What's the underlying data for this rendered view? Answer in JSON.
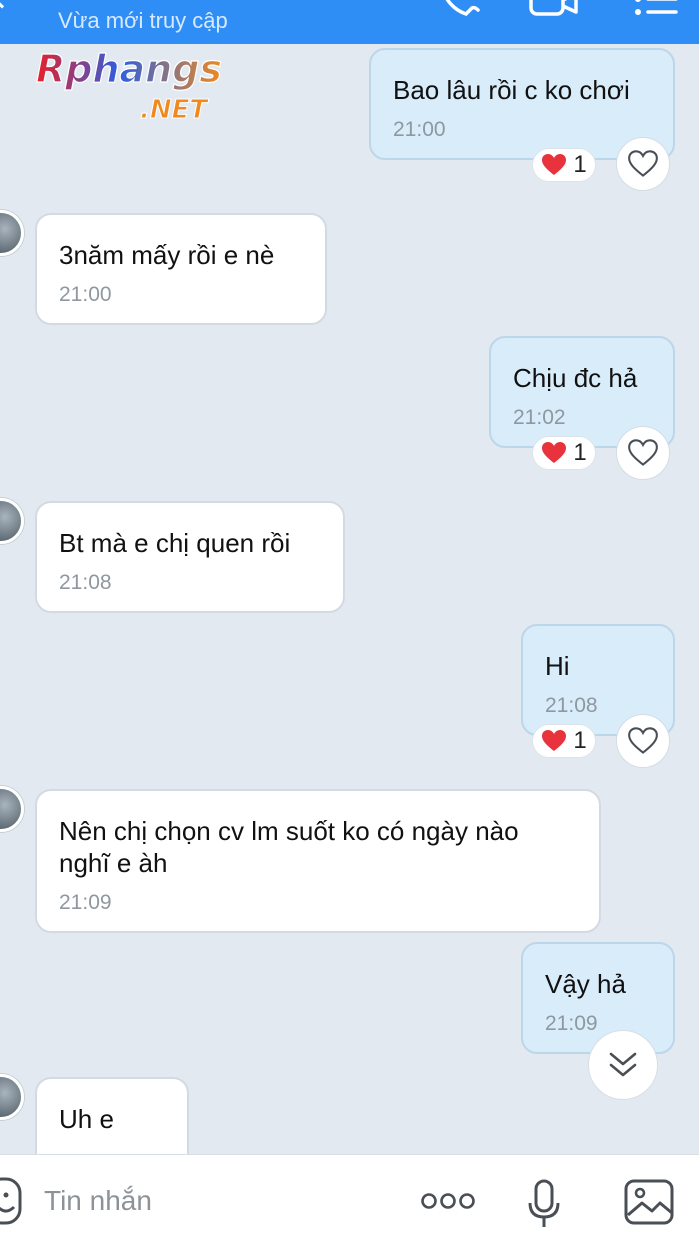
{
  "header": {
    "status": "Vừa mới truy cập"
  },
  "logo": {
    "line1": "Rphangs",
    "line2": ".NET"
  },
  "messages": [
    {
      "text": "Bao lâu rồi c ko chơi",
      "time": "21:00",
      "reaction_count": "1"
    },
    {
      "text": "3năm mấy rồi e nè",
      "time": "21:00"
    },
    {
      "text": "Chịu đc hả",
      "time": "21:02",
      "reaction_count": "1"
    },
    {
      "text": "Bt mà e chị quen rồi",
      "time": "21:08"
    },
    {
      "text": "Hi",
      "time": "21:08",
      "reaction_count": "1"
    },
    {
      "text": "Nên chị chọn cv lm suốt ko có ngày nào\nnghĩ e àh",
      "time": "21:09"
    },
    {
      "text": "Vậy hả",
      "time": "21:09"
    },
    {
      "text": "Uh e",
      "time": ""
    }
  ],
  "composer": {
    "placeholder": "Tin nhắn"
  },
  "colors": {
    "header": "#2f8ef5",
    "sent_bubble": "#d8ecfa",
    "recv_bubble": "#ffffff",
    "background": "#e2e9f1",
    "heart": "#e8323c"
  },
  "icons": [
    "phone-icon",
    "video-icon",
    "menu-icon",
    "heart-icon",
    "heart-outline-icon",
    "double-chevron-down-icon",
    "emoji-icon",
    "more-icon",
    "microphone-icon",
    "image-icon"
  ]
}
